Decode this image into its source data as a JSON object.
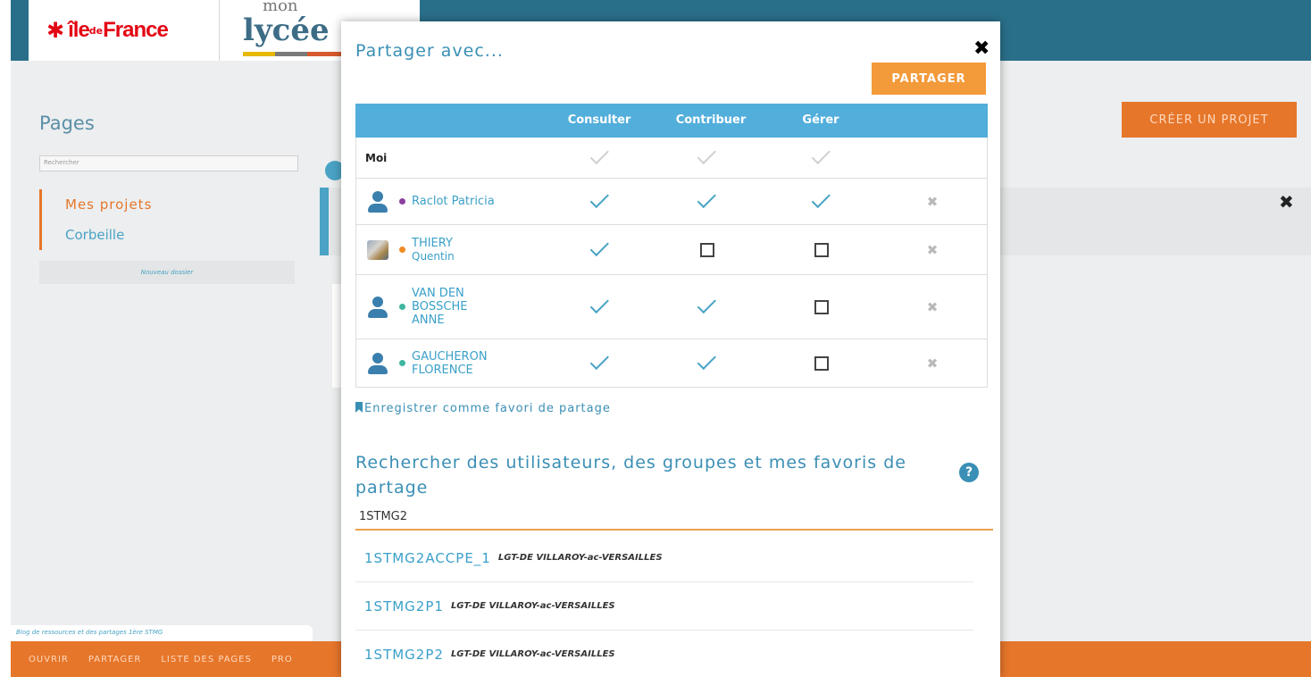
{
  "header": {
    "region_logo": {
      "star": "✱",
      "ile": "île",
      "de": "de",
      "france": "France"
    },
    "lycee_logo": {
      "mon": "mon",
      "lycee": "lycée"
    }
  },
  "sidebar": {
    "title": "Pages",
    "search_placeholder": "Rechercher",
    "items": [
      {
        "label": "Mes projets",
        "active": true
      },
      {
        "label": "Corbeille",
        "active": false
      }
    ],
    "new_folder": "Nouveau dossier"
  },
  "main": {
    "create_project": "CRÉER UN PROJET",
    "close_glyph": "✖"
  },
  "blog_tab": "Blog de ressources et des partages 1ère STMG",
  "bottom_menu": [
    "OUVRIR",
    "PARTAGER",
    "LISTE DES PAGES",
    "PRO"
  ],
  "modal": {
    "title": "Partager avec...",
    "close_glyph": "✖",
    "share_button": "PARTAGER",
    "columns": {
      "consult": "Consulter",
      "contribute": "Contribuer",
      "manage": "Gérer"
    },
    "owner": {
      "name": "Moi"
    },
    "users": [
      {
        "name": "Raclot Patricia",
        "dot": "#8a3fa0",
        "avatar": "user-icon",
        "consult": true,
        "contribute": true,
        "manage": true
      },
      {
        "name": "THIERY",
        "sub": "Quentin",
        "dot": "#f08a24",
        "avatar": "photo",
        "consult": true,
        "contribute": false,
        "manage": false
      },
      {
        "name": "VAN DEN BOSSCHE ANNE",
        "dot": "#3fb6a0",
        "avatar": "user-icon",
        "consult": true,
        "contribute": true,
        "manage": false
      },
      {
        "name": "GAUCHERON FLORENCE",
        "dot": "#3fb6a0",
        "avatar": "user-icon",
        "consult": true,
        "contribute": true,
        "manage": false
      }
    ],
    "remove_glyph": "✖",
    "favorite_save": "Enregistrer comme favori de partage",
    "search_title": "Rechercher des utilisateurs, des groupes et mes favoris de partage",
    "help_glyph": "?",
    "search_value": "1STMG2",
    "results": [
      {
        "name": "1STMG2ACCPE_1",
        "school": "LGT-DE VILLAROY-ac-VERSAILLES"
      },
      {
        "name": "1STMG2P1",
        "school": "LGT-DE VILLAROY-ac-VERSAILLES"
      },
      {
        "name": "1STMG2P2",
        "school": "LGT-DE VILLAROY-ac-VERSAILLES"
      }
    ]
  },
  "colors": {
    "topbar": "#2a6f8a",
    "accent_orange": "#e6762a",
    "share_orange": "#f39a3a",
    "table_header": "#52aedb",
    "link_blue": "#3aa0c9"
  }
}
